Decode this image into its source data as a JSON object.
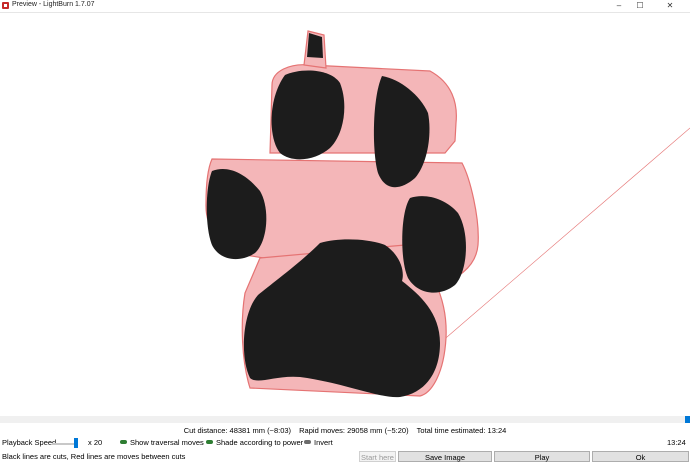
{
  "window": {
    "title": "Preview - LightBurn 1.7.07",
    "minimize": "–",
    "maximize": "☐",
    "close": "✕"
  },
  "preview": {
    "cut_color": "#1c1c1c",
    "traversal_color": "#f4b6b8",
    "outline_color": "#e57373"
  },
  "stats": {
    "cut_distance": "Cut distance: 48381 mm (~8:03)",
    "rapid_moves": "Rapid moves: 29058 mm (~5:20)",
    "total_time": "Total time estimated: 13:24"
  },
  "controls": {
    "playback_speed_label": "Playback Speed",
    "speed_multiplier": "x 20",
    "show_traversal": "Show traversal moves",
    "shade_power": "Shade according to power",
    "invert": "Invert",
    "elapsed_time": "13:24"
  },
  "status": {
    "legend": "Black lines are cuts, Red lines are moves between cuts"
  },
  "buttons": {
    "start_here": "Start here",
    "save_image": "Save Image",
    "play": "Play",
    "ok": "Ok"
  }
}
